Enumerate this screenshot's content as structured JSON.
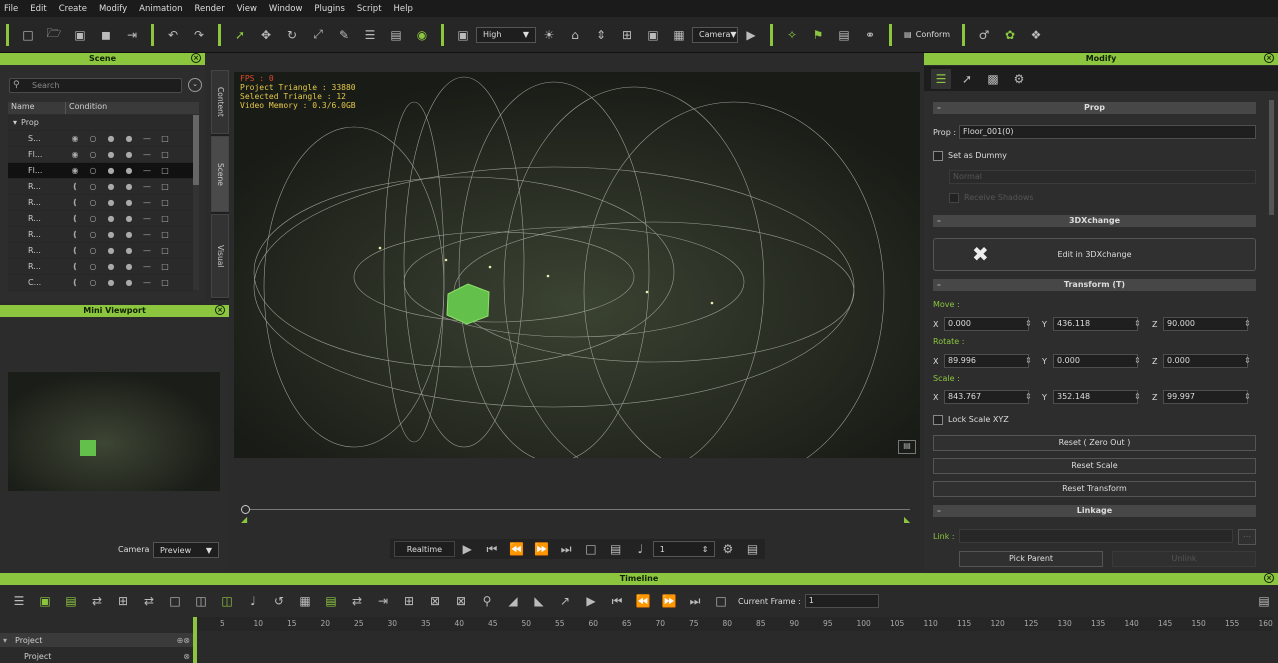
{
  "menu": [
    "File",
    "Edit",
    "Create",
    "Modify",
    "Animation",
    "Render",
    "View",
    "Window",
    "Plugins",
    "Script",
    "Help"
  ],
  "toolbar": {
    "quality": "High",
    "camera": "Camera",
    "conform": "Conform"
  },
  "scene": {
    "title": "Scene",
    "search_placeholder": "Search",
    "col_name": "Name",
    "col_condition": "Condition",
    "group": "Prop",
    "rows": [
      "S...",
      "Fl...",
      "Fl...",
      "R...",
      "R...",
      "R...",
      "R...",
      "R...",
      "R...",
      "C..."
    ],
    "tabs": [
      "Content",
      "Scene",
      "Visual"
    ]
  },
  "mini": {
    "title": "Mini Viewport",
    "camera_label": "Camera",
    "camera_value": "Preview"
  },
  "viewport": {
    "fps": "FPS : 0",
    "triangles": "Project Triangle : 33880",
    "selected": "Selected Triangle : 12",
    "memory": "Video Memory : 0.3/6.0GB"
  },
  "playback": {
    "mode": "Realtime",
    "frame": "1"
  },
  "modify": {
    "title": "Modify",
    "prop_section": "Prop",
    "prop_label": "Prop :",
    "prop_value": "Floor_001(0)",
    "dummy": "Set as Dummy",
    "normal": "Normal",
    "receive": "Receive Shadows",
    "xchange_section": "3DXchange",
    "xchange_btn": "Edit in 3DXchange",
    "transform_section": "Transform  (T)",
    "move": "Move :",
    "rotate": "Rotate :",
    "scale": "Scale :",
    "axis_x": "X",
    "axis_y": "Y",
    "axis_z": "Z",
    "move_x": "0.000",
    "move_y": "436.118",
    "move_z": "90.000",
    "rot_x": "89.996",
    "rot_y": "0.000",
    "rot_z": "0.000",
    "scale_x": "843.767",
    "scale_y": "352.148",
    "scale_z": "99.997",
    "lock": "Lock Scale XYZ",
    "reset_zero": "Reset ( Zero Out )",
    "reset_scale": "Reset Scale",
    "reset_transform": "Reset Transform",
    "linkage_section": "Linkage",
    "link_label": "Link :",
    "pick_parent": "Pick Parent",
    "unlink": "Unlink"
  },
  "timeline": {
    "title": "Timeline",
    "current_frame_label": "Current Frame :",
    "current_frame": "1",
    "ticks": [
      "5",
      "10",
      "15",
      "20",
      "25",
      "30",
      "35",
      "40",
      "45",
      "50",
      "55",
      "60",
      "65",
      "70",
      "75",
      "80",
      "85",
      "90",
      "95",
      "100",
      "105",
      "110",
      "115",
      "120",
      "125",
      "130",
      "135",
      "140",
      "145",
      "150",
      "155",
      "160"
    ],
    "track1": "Project",
    "track2": "Project"
  }
}
